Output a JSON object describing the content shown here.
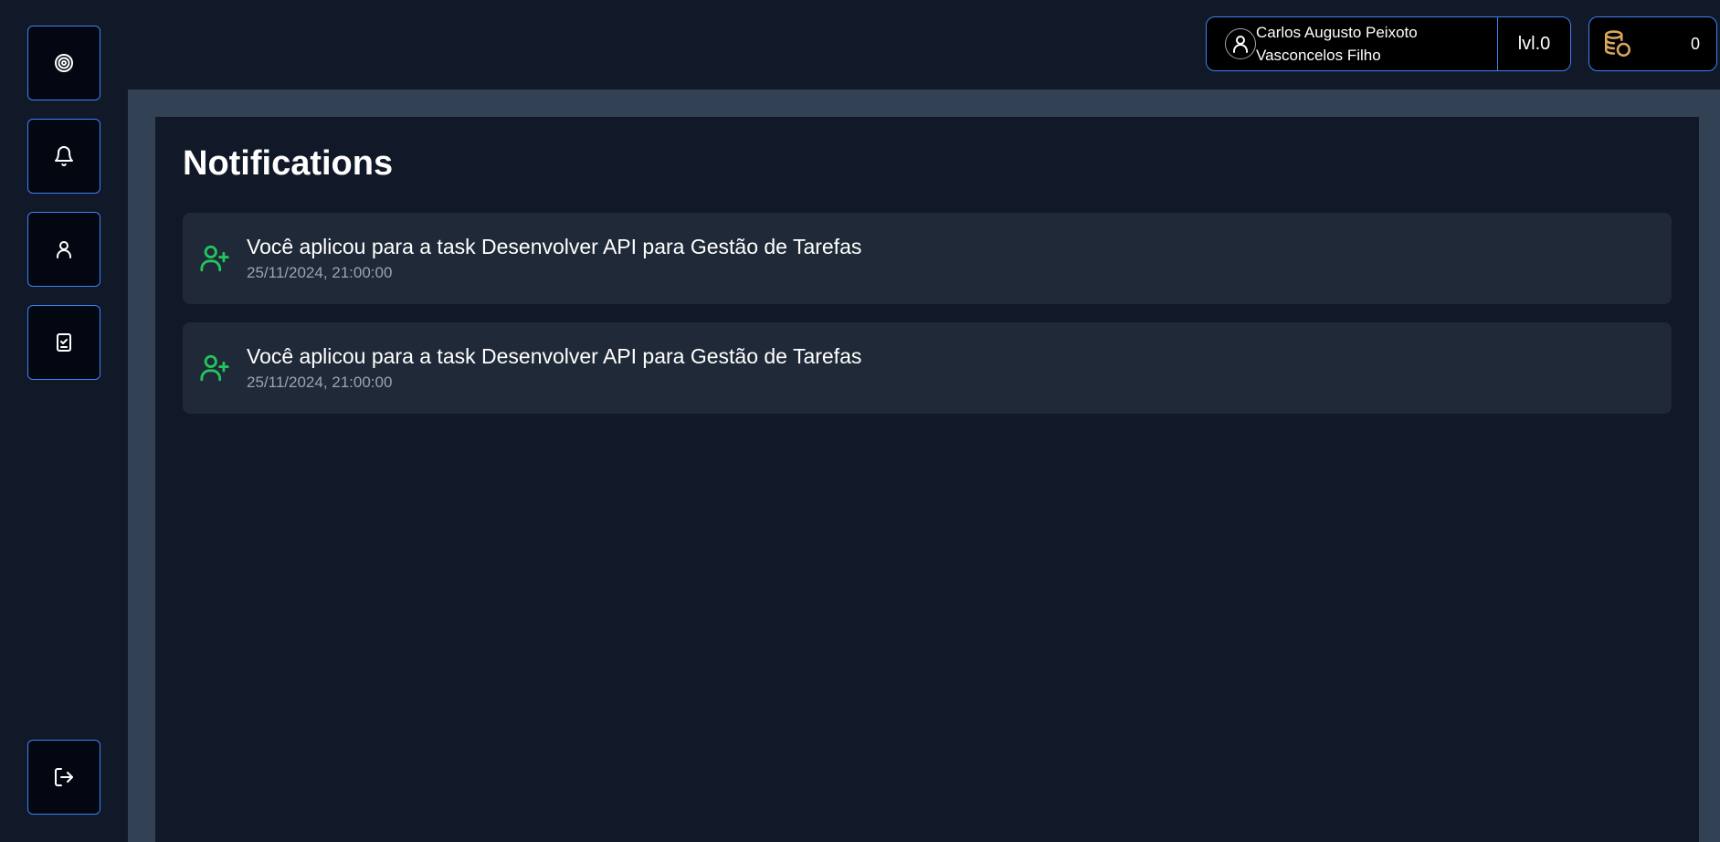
{
  "sidebar": {
    "items": [
      {
        "icon": "target-icon"
      },
      {
        "icon": "bell-icon"
      },
      {
        "icon": "user-icon"
      },
      {
        "icon": "clipboard-check-icon"
      }
    ],
    "logout": {
      "icon": "logout-icon"
    }
  },
  "header": {
    "user_name": "Carlos Augusto Peixoto Vasconcelos Filho",
    "level": "lvl.0",
    "coins": "0",
    "coins_icon": "coins-icon"
  },
  "main": {
    "title": "Notifications",
    "notifications": [
      {
        "icon": "user-plus-icon",
        "message": "Você aplicou para a task Desenvolver API para Gestão de Tarefas",
        "time": "25/11/2024, 21:00:00"
      },
      {
        "icon": "user-plus-icon",
        "message": "Você aplicou para a task Desenvolver API para Gestão de Tarefas",
        "time": "25/11/2024, 21:00:00"
      }
    ]
  },
  "colors": {
    "background": "#111827",
    "frame": "#334155",
    "card": "#1f2937",
    "accent_border": "#3b82f6",
    "icon_green": "#22c55e",
    "coin_gold": "#d9a85a"
  }
}
